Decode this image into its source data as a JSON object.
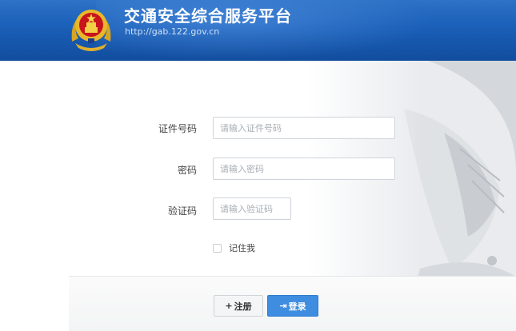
{
  "header": {
    "title": "交通安全综合服务平台",
    "url": "http://gab.122.gov.cn",
    "emblem_icon": "police-badge-emblem"
  },
  "form": {
    "id_label": "证件号码",
    "id_placeholder": "请输入证件号码",
    "password_label": "密码",
    "password_placeholder": "请输入密码",
    "captcha_label": "验证码",
    "captcha_placeholder": "请输入验证码",
    "remember_label": "记住我",
    "remember_checked": false
  },
  "actions": {
    "register_icon": "+",
    "register_label": "注册",
    "login_icon": "⇥",
    "login_label": "登录"
  },
  "colors": {
    "header_blue": "#1a5fb8",
    "login_button": "#3f8de0"
  }
}
